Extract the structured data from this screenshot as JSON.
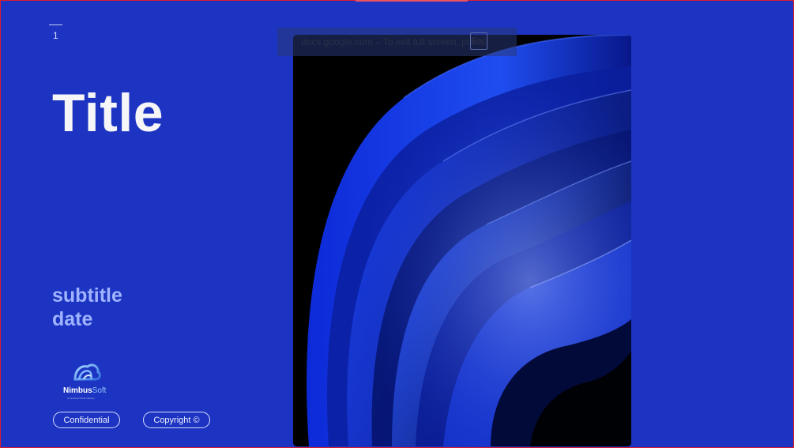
{
  "slide": {
    "number": "1",
    "title": "Title",
    "subtitle": "subtitle",
    "date": "date"
  },
  "logo": {
    "name_primary": "Nimbus",
    "name_secondary": "Soft",
    "tagline": "Connected Cloud Industry",
    "icon": "cloud-wave-logo-icon"
  },
  "pills": {
    "confidential": "Confidential",
    "copyright": "Copyright ©"
  },
  "fullscreen_banner": {
    "message": "docs.google.com – To exit full screen, press",
    "key": "Esc"
  },
  "colors": {
    "background": "#1c34c1",
    "title": "#f6f6f8",
    "subtitle": "#9fb3ff",
    "border": "#e01b2b"
  }
}
